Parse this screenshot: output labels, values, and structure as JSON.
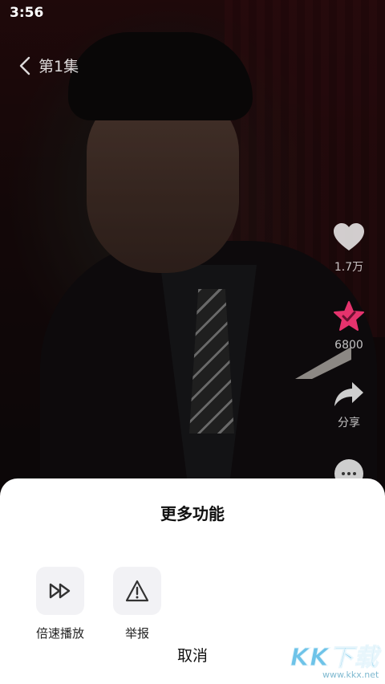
{
  "status_bar": {
    "time": "3:56"
  },
  "player": {
    "episode_title": "第1集",
    "actions": {
      "like": {
        "icon": "heart-icon",
        "count": "1.7万"
      },
      "favorite": {
        "icon": "star-icon",
        "count": "6800",
        "color": "#e5336d"
      },
      "share": {
        "icon": "share-arrow-icon",
        "label": "分享"
      },
      "more": {
        "icon": "more-dots-icon"
      }
    }
  },
  "sheet": {
    "title": "更多功能",
    "items": [
      {
        "label": "倍速播放",
        "icon": "fast-forward-icon"
      },
      {
        "label": "举报",
        "icon": "warning-icon"
      }
    ],
    "cancel_label": "取消"
  },
  "watermark": {
    "text": "KK下载",
    "sub": "www.kkx.net"
  }
}
